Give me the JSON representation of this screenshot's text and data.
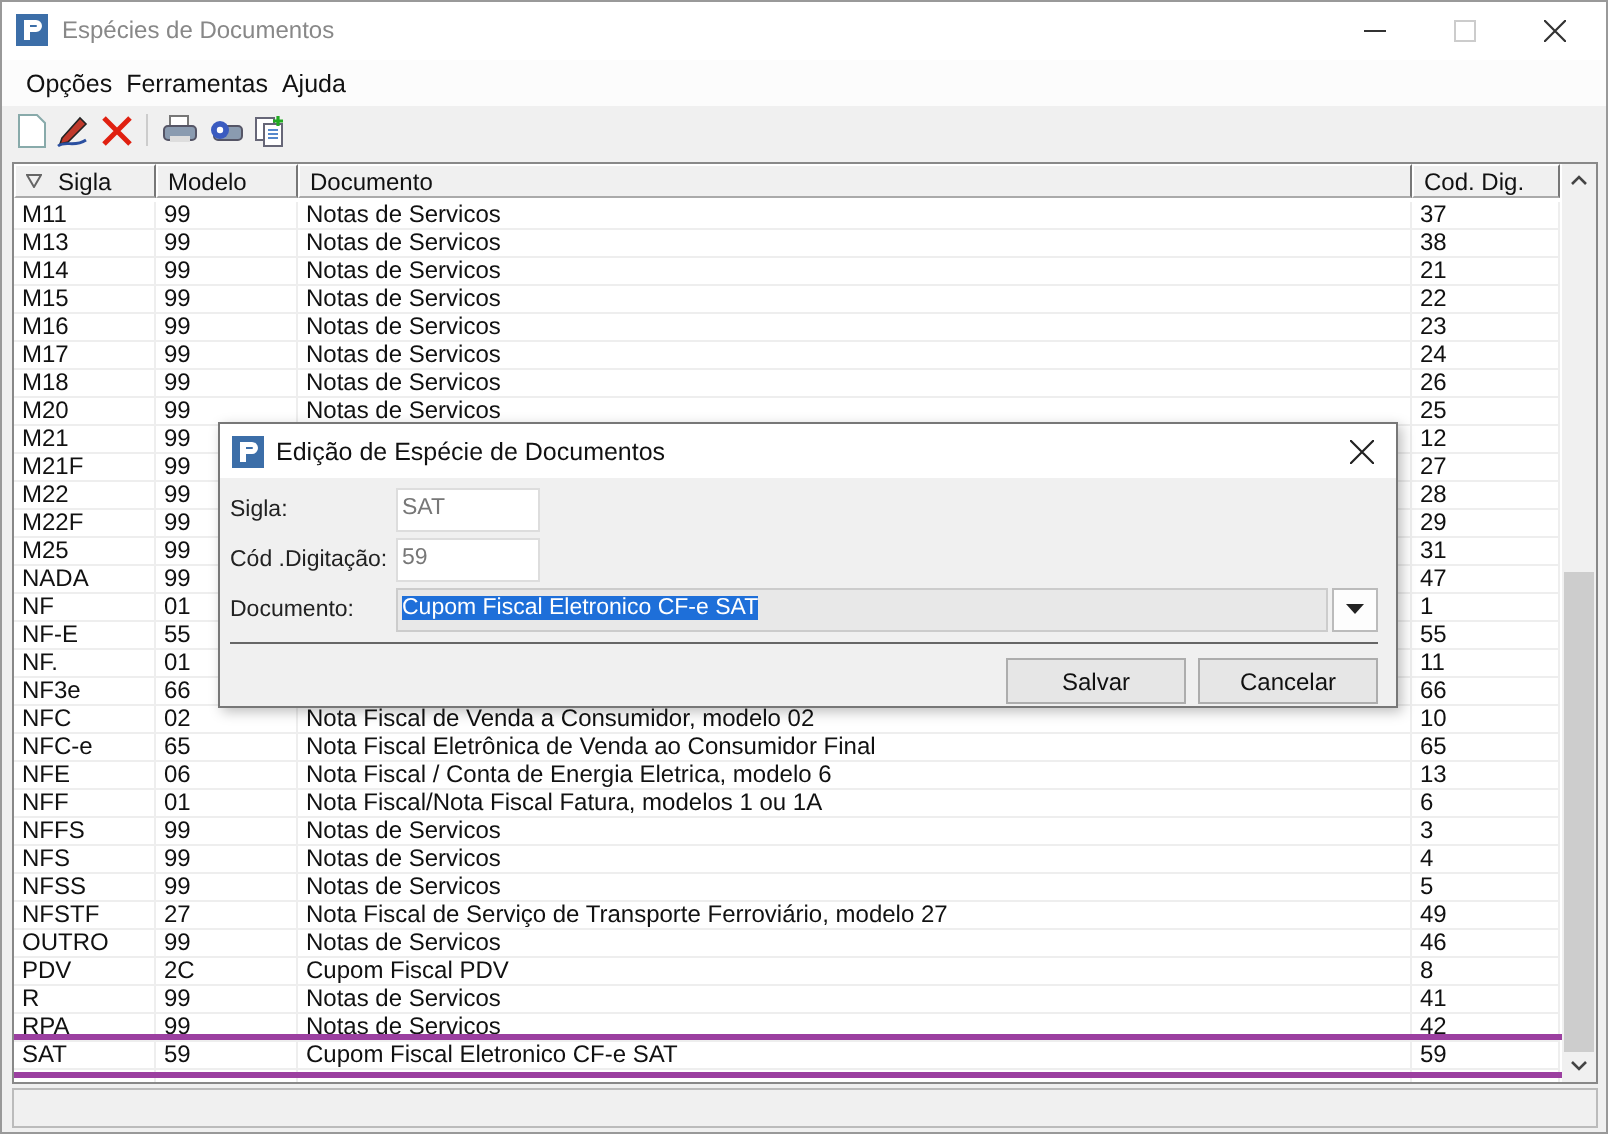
{
  "window": {
    "title": "Espécies de Documentos"
  },
  "menu": [
    "Opções",
    "Ferramentas",
    "Ajuda"
  ],
  "table": {
    "columns": [
      "Sigla",
      "Modelo",
      "Documento",
      "Cod. Dig."
    ],
    "rows": [
      {
        "sigla": "M11",
        "modelo": "99",
        "documento": "Notas de Servicos",
        "cod": "37",
        "selected": false
      },
      {
        "sigla": "M13",
        "modelo": "99",
        "documento": "Notas de Servicos",
        "cod": "38",
        "selected": false
      },
      {
        "sigla": "M14",
        "modelo": "99",
        "documento": "Notas de Servicos",
        "cod": "21",
        "selected": false
      },
      {
        "sigla": "M15",
        "modelo": "99",
        "documento": "Notas de Servicos",
        "cod": "22",
        "selected": false
      },
      {
        "sigla": "M16",
        "modelo": "99",
        "documento": "Notas de Servicos",
        "cod": "23",
        "selected": false
      },
      {
        "sigla": "M17",
        "modelo": "99",
        "documento": "Notas de Servicos",
        "cod": "24",
        "selected": false
      },
      {
        "sigla": "M18",
        "modelo": "99",
        "documento": "Notas de Servicos",
        "cod": "26",
        "selected": false
      },
      {
        "sigla": "M20",
        "modelo": "99",
        "documento": "Notas de Servicos",
        "cod": "25",
        "selected": false
      },
      {
        "sigla": "M21",
        "modelo": "99",
        "cod": "12",
        "selected": false
      },
      {
        "sigla": "M21F",
        "modelo": "99",
        "cod": "27",
        "selected": false
      },
      {
        "sigla": "M22",
        "modelo": "99",
        "cod": "28",
        "selected": false
      },
      {
        "sigla": "M22F",
        "modelo": "99",
        "cod": "29",
        "selected": false
      },
      {
        "sigla": "M25",
        "modelo": "99",
        "cod": "31",
        "selected": false
      },
      {
        "sigla": "NADA",
        "modelo": "99",
        "cod": "47",
        "selected": false
      },
      {
        "sigla": "NF",
        "modelo": "01",
        "cod": "1",
        "selected": false
      },
      {
        "sigla": "NF-E",
        "modelo": "55",
        "cod": "55",
        "selected": false
      },
      {
        "sigla": "NF.",
        "modelo": "01",
        "cod": "11",
        "selected": false
      },
      {
        "sigla": "NF3e",
        "modelo": "66",
        "cod": "66",
        "selected": false
      },
      {
        "sigla": "NFC",
        "modelo": "02",
        "documento": "Nota Fiscal de Venda a Consumidor, modelo 02",
        "cod": "10",
        "selected": false
      },
      {
        "sigla": "NFC-e",
        "modelo": "65",
        "documento": "Nota Fiscal Eletrônica de Venda ao Consumidor Final",
        "cod": "65",
        "selected": false
      },
      {
        "sigla": "NFE",
        "modelo": "06",
        "documento": "Nota Fiscal / Conta de Energia Eletrica, modelo 6",
        "cod": "13",
        "selected": false
      },
      {
        "sigla": "NFF",
        "modelo": "01",
        "documento": "Nota Fiscal/Nota Fiscal Fatura, modelos 1 ou 1A",
        "cod": "6",
        "selected": false
      },
      {
        "sigla": "NFFS",
        "modelo": "99",
        "documento": "Notas de Servicos",
        "cod": "3",
        "selected": false
      },
      {
        "sigla": "NFS",
        "modelo": "99",
        "documento": "Notas de Servicos",
        "cod": "4",
        "selected": false
      },
      {
        "sigla": "NFSS",
        "modelo": "99",
        "documento": "Notas de Servicos",
        "cod": "5",
        "selected": false
      },
      {
        "sigla": "NFSTF",
        "modelo": "27",
        "documento": "Nota Fiscal de Serviço de Transporte Ferroviário, modelo 27",
        "cod": "49",
        "selected": false
      },
      {
        "sigla": "OUTRO",
        "modelo": "99",
        "documento": "Notas de Servicos",
        "cod": "46",
        "selected": false
      },
      {
        "sigla": "PDV",
        "modelo": "2C",
        "documento": "Cupom Fiscal PDV",
        "cod": "8",
        "selected": false
      },
      {
        "sigla": "R",
        "modelo": "99",
        "documento": "Notas de Servicos",
        "cod": "41",
        "selected": false
      },
      {
        "sigla": "RPA",
        "modelo": "99",
        "documento": "Notas de Servicos",
        "cod": "42",
        "selected": false
      },
      {
        "sigla": "SAT",
        "modelo": "59",
        "documento": "Cupom Fiscal Eletronico CF-e SAT",
        "cod": "59",
        "selected": true
      }
    ]
  },
  "dialog": {
    "title": "Edição de Espécie de Documentos",
    "fields": [
      {
        "label": "Sigla:",
        "value": "SAT",
        "kind": "text"
      },
      {
        "label": "Cód .Digitação:",
        "value": "59",
        "kind": "text"
      },
      {
        "label": "Documento:",
        "value": "Cupom Fiscal Eletronico CF-e SAT",
        "kind": "combo",
        "selected": true
      }
    ],
    "buttons": [
      "Salvar",
      "Cancelar"
    ]
  }
}
